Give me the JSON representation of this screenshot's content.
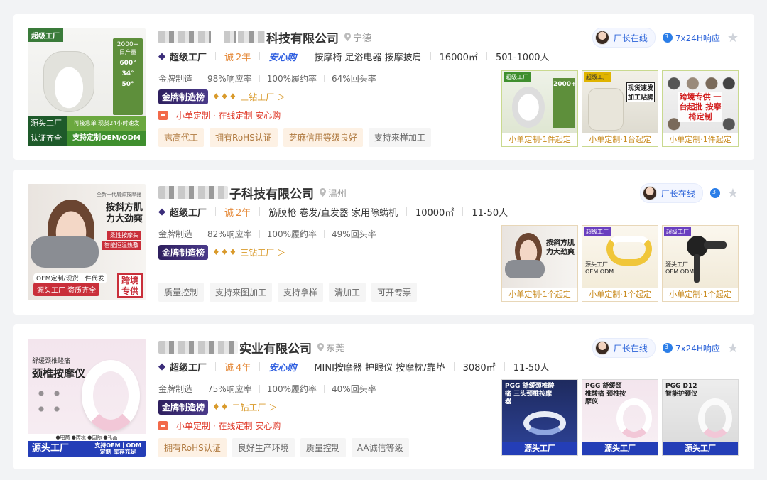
{
  "listings": [
    {
      "company_visible": "科技有限公司",
      "location": "宁德",
      "factory_label": "超级工厂",
      "years": "2年",
      "years_icon": "诚",
      "anxin": "安心购",
      "categories": "按摩椅 足浴电器 按摩披肩",
      "area": "16000㎡",
      "staff": "501-1000人",
      "stats": [
        "金牌制造",
        "98%响应率",
        "100%履约率",
        "64%回头率"
      ],
      "rank_badge": "金牌制造榜",
      "rank_link": "三钻工厂 ＞",
      "custom": "小单定制 · 在线定制 安心购",
      "tags": [
        {
          "text": "志高代工",
          "hl": true
        },
        {
          "text": "拥有RoHS认证",
          "hl": true
        },
        {
          "text": "芝麻信用等级良好",
          "hl": true
        },
        {
          "text": "支持来样加工",
          "hl": false
        }
      ],
      "online": "厂长在线",
      "response": "7x24H响应",
      "main_image": {
        "badge": "超级工厂",
        "yield_top": "2000+",
        "yield_label": "日产量",
        "yield_vals": [
          "600°",
          "34°",
          "50°"
        ],
        "bar_line": "可接急单 现货24小时速发",
        "bottom_left": "源头工厂\n认证齐全",
        "bottom_right": "支持定制OEM/ODM"
      },
      "products": [
        {
          "caption": "小单定制·1件起定",
          "img_text": "2000+"
        },
        {
          "caption": "小单定制·1台起定",
          "img_text": "现货速发 加工贴牌"
        },
        {
          "caption": "小单定制·1件起定",
          "img_text": "跨境专供 一台起批 按摩椅定制"
        }
      ]
    },
    {
      "company_visible": "子科技有限公司",
      "location": "温州",
      "factory_label": "超级工厂",
      "years": "2年",
      "years_icon": "诚",
      "anxin": "",
      "categories": "筋膜枪 卷发/直发器 家用除螨机",
      "area": "10000㎡",
      "staff": "11-50人",
      "stats": [
        "金牌制造",
        "82%响应率",
        "100%履约率",
        "49%回头率"
      ],
      "rank_badge": "金牌制造榜",
      "rank_link": "三钻工厂 ＞",
      "custom": "",
      "tags": [
        {
          "text": "质量控制",
          "hl": false
        },
        {
          "text": "支持来图加工",
          "hl": false
        },
        {
          "text": "支持拿样",
          "hl": false
        },
        {
          "text": "清加工",
          "hl": false
        },
        {
          "text": "可开专票",
          "hl": false
        }
      ],
      "online": "厂长在线",
      "response": "",
      "main_image": {
        "top": "全新一代肩颈按摩器",
        "headline": "按斜方肌\n力大劲爽",
        "tag1": "柔性按摩头",
        "tag2": "智能恒温热敷",
        "oem": "OEM定制/现货一件代发",
        "source": "源头工厂 资质齐全",
        "cross": "跨境\n专供"
      },
      "products": [
        {
          "caption": "小单定制·1个起定",
          "img_text": "按斜方肌 力大劲爽"
        },
        {
          "caption": "小单定制·1个起定",
          "img_text": "源头工厂 OEM.ODM"
        },
        {
          "caption": "小单定制·1个起定",
          "img_text": "源头工厂 OEM.ODM"
        }
      ]
    },
    {
      "company_visible": "实业有限公司",
      "location": "东莞",
      "factory_label": "超级工厂",
      "years": "4年",
      "years_icon": "诚",
      "anxin": "安心购",
      "categories": "MINI按摩器 护眼仪 按摩枕/靠垫",
      "area": "3080㎡",
      "staff": "11-50人",
      "stats": [
        "金牌制造",
        "75%响应率",
        "100%履约率",
        "40%回头率"
      ],
      "rank_badge": "金牌制造榜",
      "rank_link": "二钻工厂 ＞",
      "custom": "小单定制 · 在线定制 安心购",
      "tags": [
        {
          "text": "拥有RoHS认证",
          "hl": true
        },
        {
          "text": "良好生产环境",
          "hl": false
        },
        {
          "text": "质量控制",
          "hl": false
        },
        {
          "text": "AA诚信等级",
          "hl": false
        }
      ],
      "online": "厂长在线",
      "response": "7x24H响应",
      "main_image": {
        "top": "舒缓颈椎酸痛",
        "headline": "颈椎按摩仪",
        "strip": "●电商 ●跨境 ●国际 ●礼品",
        "bottom": "源头工厂",
        "bottom_right": "支持OEM丨ODM\n定制 库存充足"
      },
      "products": [
        {
          "caption": "源头工厂",
          "img_text": "PGG 舒缓颈椎酸痛 三头颈椎按摩器"
        },
        {
          "caption": "源头工厂",
          "img_text": "PGG 舒缓颈椎酸痛 颈椎按摩仪"
        },
        {
          "caption": "源头工厂",
          "img_text": "PGG D12 智能护颈仪"
        }
      ]
    }
  ]
}
